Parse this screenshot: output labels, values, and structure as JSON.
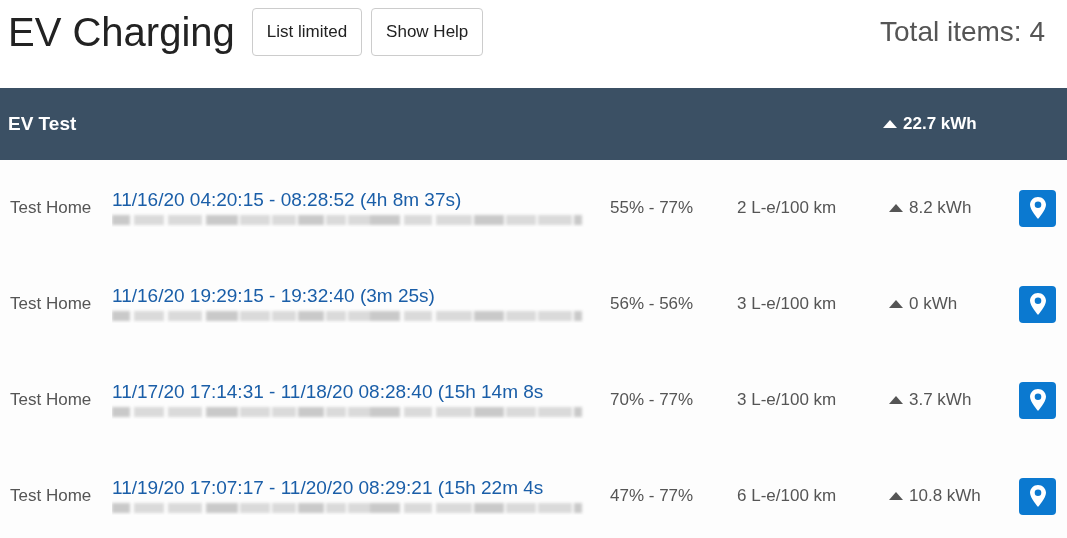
{
  "page": {
    "title": "EV Charging",
    "buttons": [
      "List limited",
      "Show Help"
    ],
    "total": "Total items: 4"
  },
  "group": {
    "name": "EV Test",
    "energy": "22.7 kWh"
  },
  "rows": [
    {
      "location": "Test Home",
      "time": "11/16/20 04:20:15 - 08:28:52 (4h 8m 37s)",
      "soc": "55% - 77%",
      "consumption": "2 L-e/100 km",
      "energy": "8.2 kWh"
    },
    {
      "location": "Test Home",
      "time": "11/16/20 19:29:15 - 19:32:40 (3m 25s)",
      "soc": "56% - 56%",
      "consumption": "3 L-e/100 km",
      "energy": "0 kWh"
    },
    {
      "location": "Test Home",
      "time": "11/17/20 17:14:31 - 11/18/20 08:28:40 (15h 14m 8s",
      "soc": "70% - 77%",
      "consumption": "3 L-e/100 km",
      "energy": "3.7 kWh"
    },
    {
      "location": "Test Home",
      "time": "11/19/20 17:07:17 - 11/20/20 08:29:21 (15h 22m 4s",
      "soc": "47% - 77%",
      "consumption": "6 L-e/100 km",
      "energy": "10.8 kWh"
    }
  ]
}
